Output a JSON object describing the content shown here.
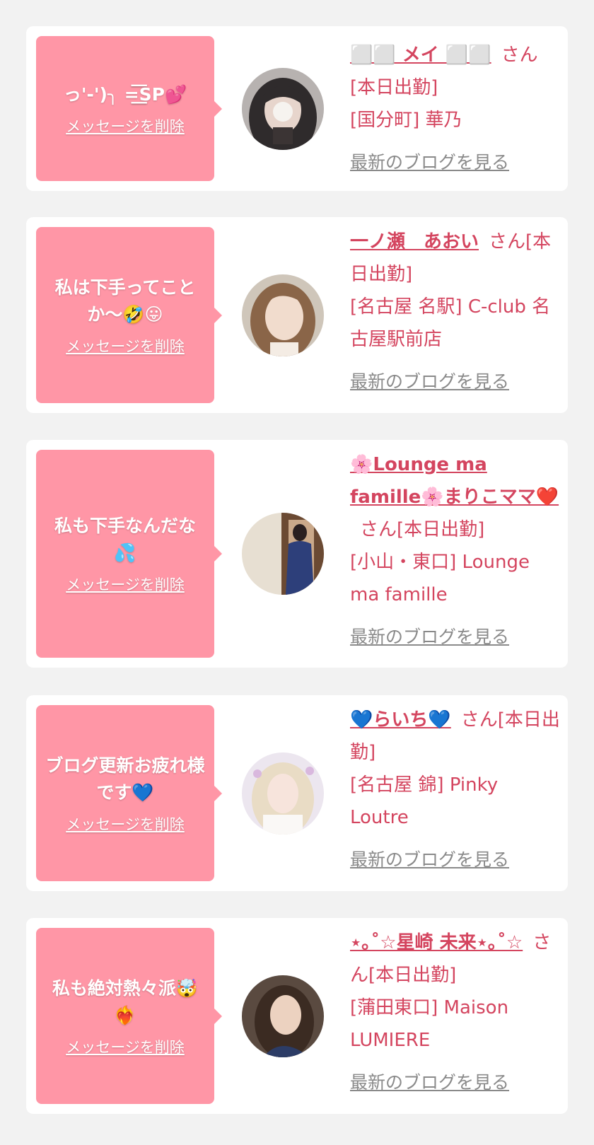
{
  "cards": [
    {
      "message": "っ'-')╮ =͟͟͞͞SP💕",
      "delete_label": "メッセージを削除",
      "name": "⬜⬜ メイ ⬜⬜",
      "status": "さん[本日出勤]",
      "shop": "[国分町] 華乃",
      "blog_label": "最新のブログを見る"
    },
    {
      "message": "私は下手ってことか〜🤣😛",
      "delete_label": "メッセージを削除",
      "name": "一ノ瀬　あおい",
      "status": "さん[本日出勤]",
      "shop": "[名古屋 名駅] C-club 名古屋駅前店",
      "blog_label": "最新のブログを見る"
    },
    {
      "message": "私も下手なんだな💦",
      "delete_label": "メッセージを削除",
      "name": "🌸Lounge ma famille🌸まりこママ❤️",
      "status": "さん[本日出勤]",
      "shop": "[小山・東口] Lounge ma famille",
      "blog_label": "最新のブログを見る"
    },
    {
      "message": "ブログ更新お疲れ様です💙",
      "delete_label": "メッセージを削除",
      "name": "💙らいち💙",
      "status": "さん[本日出勤]",
      "shop": "[名古屋 錦] Pinky Loutre",
      "blog_label": "最新のブログを見る"
    },
    {
      "message": "私も絶対熱々派🤯❤️‍🔥",
      "delete_label": "メッセージを削除",
      "name": "⋆｡˚☆星崎 未来⋆｡˚☆",
      "status": "さん[本日出勤]",
      "shop": "[蒲田東口] Maison LUMIERE",
      "blog_label": "最新のブログを見る"
    }
  ],
  "colors": {
    "bubble": "#ff96a6",
    "accent_text": "#d4455f",
    "link_gray": "#8a8a8a",
    "background": "#f2f2f2"
  }
}
